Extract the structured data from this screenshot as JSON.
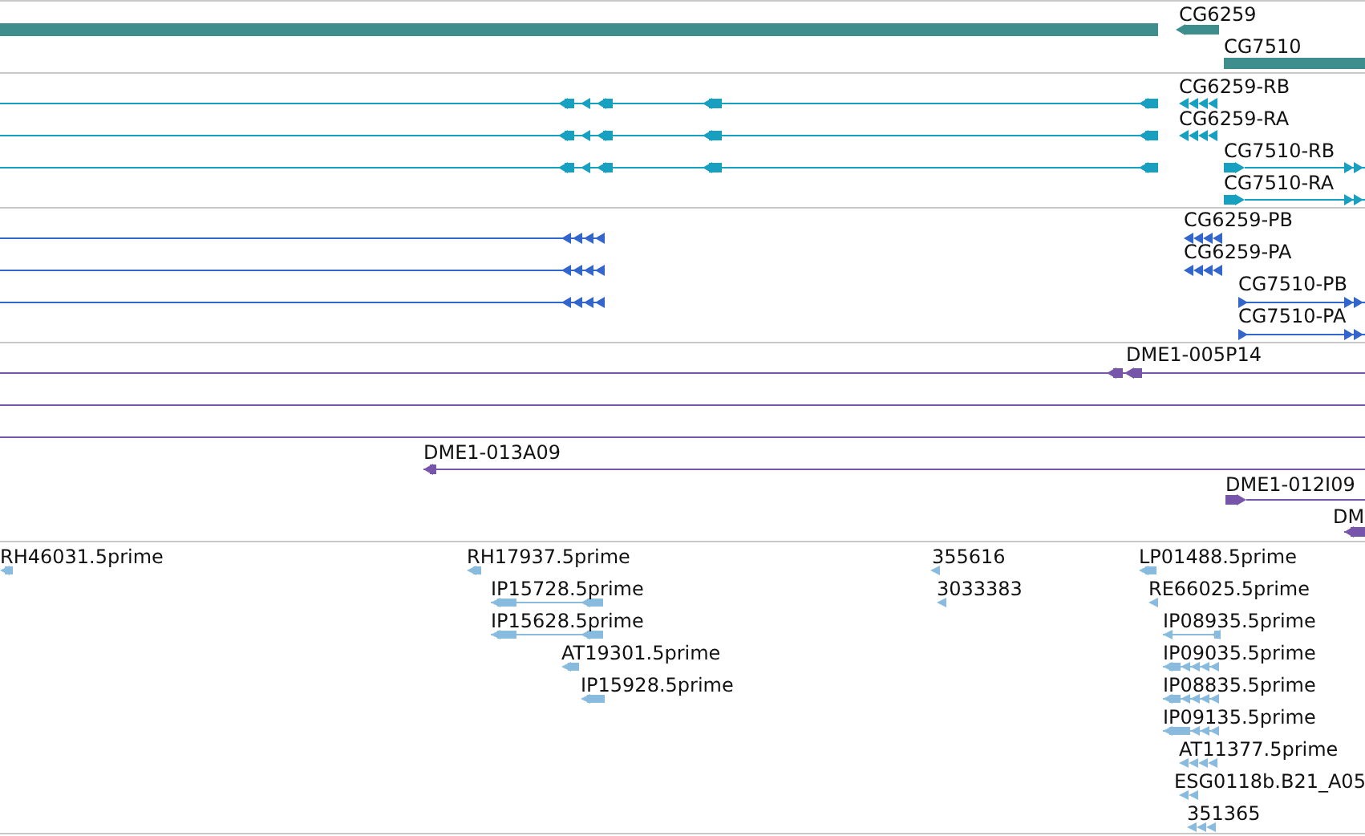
{
  "tracks": [
    {
      "color": "#3f8e8e",
      "features": [
        {
          "label": "CG6259"
        },
        {
          "label": "CG7510"
        }
      ]
    },
    {
      "color": "#17a0c0",
      "features": [
        {
          "label": "CG6259-RB"
        },
        {
          "label": "CG6259-RA"
        },
        {
          "label": "CG7510-RB"
        },
        {
          "label": "CG7510-RA"
        }
      ]
    },
    {
      "color": "#3366cc",
      "features": [
        {
          "label": "CG6259-PB"
        },
        {
          "label": "CG6259-PA"
        },
        {
          "label": "CG7510-PB"
        },
        {
          "label": "CG7510-PA"
        }
      ]
    },
    {
      "color": "#7755aa",
      "features": [
        {
          "label": "DME1-005P14"
        },
        {
          "label": "DME1-013A09"
        },
        {
          "label": "DME1-012I09"
        },
        {
          "label": "DM"
        }
      ]
    },
    {
      "color": "#88bbdd",
      "features": [
        {
          "label": "RH46031.5prime"
        },
        {
          "label": "RH17937.5prime"
        },
        {
          "label": "IP15728.5prime"
        },
        {
          "label": "IP15628.5prime"
        },
        {
          "label": "AT19301.5prime"
        },
        {
          "label": "IP15928.5prime"
        },
        {
          "label": "355616"
        },
        {
          "label": "3033383"
        },
        {
          "label": "LP01488.5prime"
        },
        {
          "label": "RE66025.5prime"
        },
        {
          "label": "IP08935.5prime"
        },
        {
          "label": "IP09035.5prime"
        },
        {
          "label": "IP08835.5prime"
        },
        {
          "label": "IP09135.5prime"
        },
        {
          "label": "AT11377.5prime"
        },
        {
          "label": "ESG0118b.B21_A05"
        },
        {
          "label": "351365"
        }
      ]
    }
  ]
}
